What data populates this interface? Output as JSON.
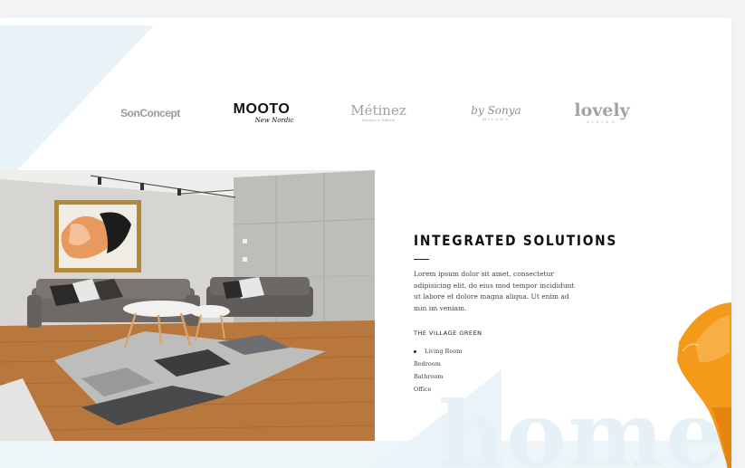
{
  "brand_logos": [
    {
      "main": "SonConcept",
      "sub": ""
    },
    {
      "main": "MOOTO",
      "sub": "New Nordic"
    },
    {
      "main": "Métinez",
      "sub": "Interior & Edition"
    },
    {
      "main": "by Sonya",
      "sub": "MILANO"
    },
    {
      "main": "lovely",
      "sub": "LIVING"
    }
  ],
  "section": {
    "title": "INTEGRATED SOLUTIONS",
    "description": "Lorem ipsum dolor sit amet, consectetur adipisicing elit, do eius mod tempor incididunt ut labore et dolore magna aliqua. Ut enim ad min  im veniam.",
    "subheading": "THE VILLAGE GREEN",
    "list": [
      {
        "label": "Living Room",
        "active": true
      },
      {
        "label": "Bedroom",
        "active": false
      },
      {
        "label": "Bathroom",
        "active": false
      },
      {
        "label": "Office",
        "active": false
      }
    ]
  },
  "watermark": "home",
  "colors": {
    "accent_orange": "#f39a1b",
    "light_blue_shape": "#e8f2f7",
    "floor_wood": "#b8783d"
  }
}
